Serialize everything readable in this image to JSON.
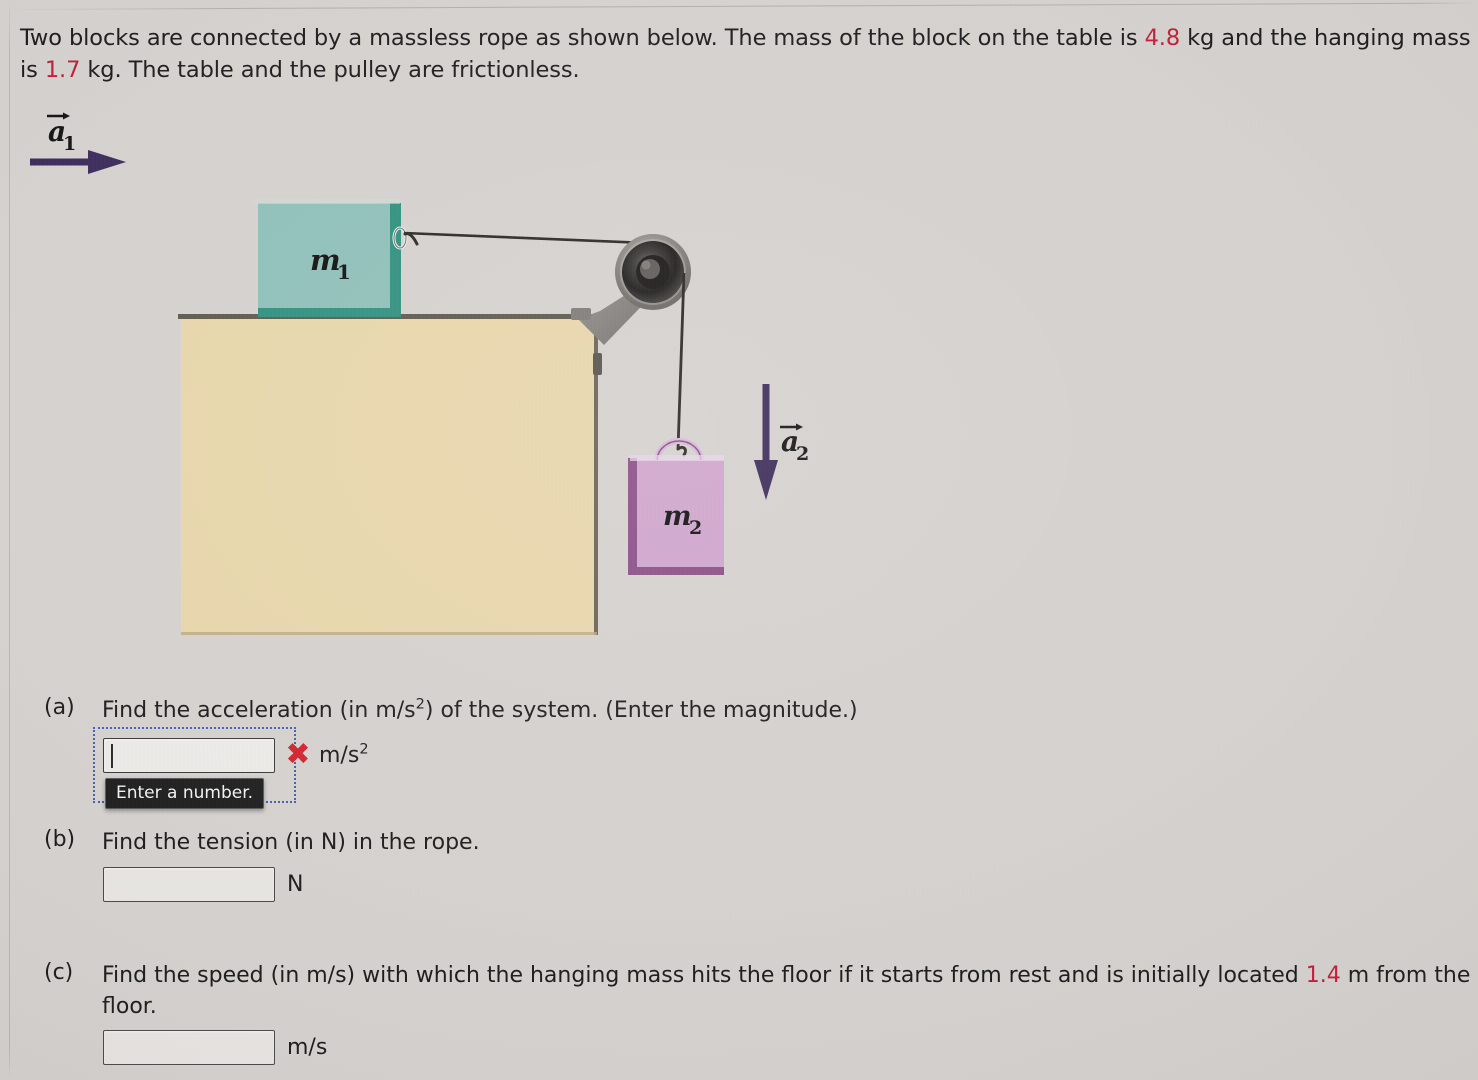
{
  "problem": {
    "text_before_mass1": "Two blocks are connected by a massless rope as shown below. The mass of the block on the table is ",
    "mass1_value": "4.8",
    "text_after_mass1": " kg and the hanging mass is ",
    "mass2_value": "1.7",
    "text_after_mass2": " kg. The table and the pulley are frictionless."
  },
  "figure": {
    "block1_label": "m",
    "block1_sub": "1",
    "block2_label": "m",
    "block2_sub": "2",
    "accel1_label": "a",
    "accel1_sub": "1",
    "accel2_label": "a",
    "accel2_sub": "2",
    "colors": {
      "block1_face": "#8ec0b8",
      "block1_edge": "#2f8f7e",
      "block2_face": "#cfa5cd",
      "block2_edge": "#8a4f88",
      "table": "#e8d6aa",
      "table_edge": "#6b6355",
      "arrow": "#3c2b5a",
      "pulley_outer": "#8d8a86",
      "pulley_mid": "#2e2c2b",
      "pulley_inner": "#565452",
      "bracket": "#8a8884",
      "rope": "#2b2623"
    }
  },
  "questions": [
    {
      "label": "(a)",
      "text_parts": [
        "Find the acceleration (in m/s",
        "2",
        ") of the system. (Enter the magnitude.)"
      ],
      "answer_value": "",
      "unit_main": "m/s",
      "unit_exp": "2",
      "focused": true,
      "status": "incorrect",
      "status_mark": "✖",
      "tooltip": "Enter a number."
    },
    {
      "label": "(b)",
      "text_parts": [
        "Find the tension (in N) in the rope."
      ],
      "answer_value": "",
      "unit_main": "N",
      "unit_exp": "",
      "focused": false,
      "status": "none",
      "status_mark": "",
      "tooltip": ""
    },
    {
      "label": "(c)",
      "text_before_value": "Find the speed (in m/s) with which the hanging mass hits the floor if it starts from rest and is initially located ",
      "value": "1.4",
      "text_after_value": " m from the floor.",
      "answer_value": "",
      "unit_main": "m/s",
      "unit_exp": "",
      "focused": false,
      "status": "none",
      "status_mark": "",
      "tooltip": ""
    }
  ]
}
